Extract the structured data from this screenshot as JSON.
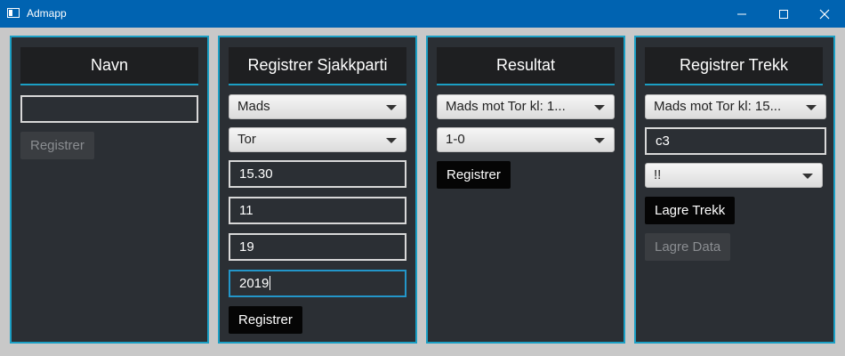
{
  "window": {
    "title": "Admapp"
  },
  "navn": {
    "header": "Navn",
    "name_value": "",
    "button": "Registrer"
  },
  "sjakkparti": {
    "header": "Registrer Sjakkparti",
    "player1": "Mads",
    "player2": "Tor",
    "time": "15.30",
    "day": "11",
    "month": "19",
    "year": "2019",
    "button": "Registrer"
  },
  "resultat": {
    "header": "Resultat",
    "game": "Mads mot Tor kl: 1...",
    "result": "1-0",
    "button": "Registrer"
  },
  "trekk": {
    "header": "Registrer Trekk",
    "game": "Mads mot Tor kl: 15...",
    "move": "c3",
    "annotation": "!!",
    "save_move_button": "Lagre Trekk",
    "save_data_button": "Lagre Data"
  }
}
